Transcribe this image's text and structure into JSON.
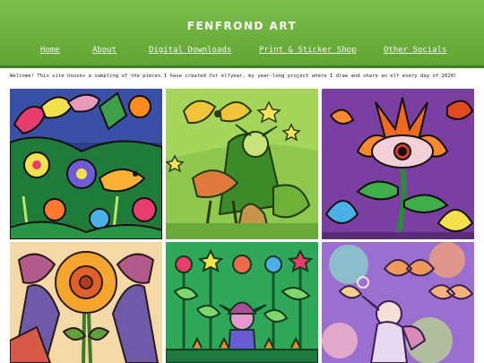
{
  "site": {
    "title": "FENFROND ART",
    "colors": {
      "header_green": "#6db23f",
      "stripe_green": "#3e7f1e",
      "nav_text": "#f3f8ea"
    }
  },
  "nav": {
    "items": [
      {
        "label": "Home"
      },
      {
        "label": "About"
      },
      {
        "label": "Digital Downloads"
      },
      {
        "label": "Print & Sticker Shop"
      },
      {
        "label": "Other Socials"
      }
    ]
  },
  "intro": {
    "text": "Welcome! This site houses a sampling of the pieces I have created for elfyear, my year-long project where I draw and share an elf every day of 2020!"
  },
  "gallery": {
    "artworks": [
      {
        "subject": "bird-and-flower-jungle-artwork"
      },
      {
        "subject": "green-elf-with-butterfly-artwork"
      },
      {
        "subject": "eye-flower-artwork"
      },
      {
        "subject": "sunflower-elves-artwork"
      },
      {
        "subject": "elf-in-garden-artwork"
      },
      {
        "subject": "pastel-elf-with-butterflies-artwork"
      }
    ]
  }
}
